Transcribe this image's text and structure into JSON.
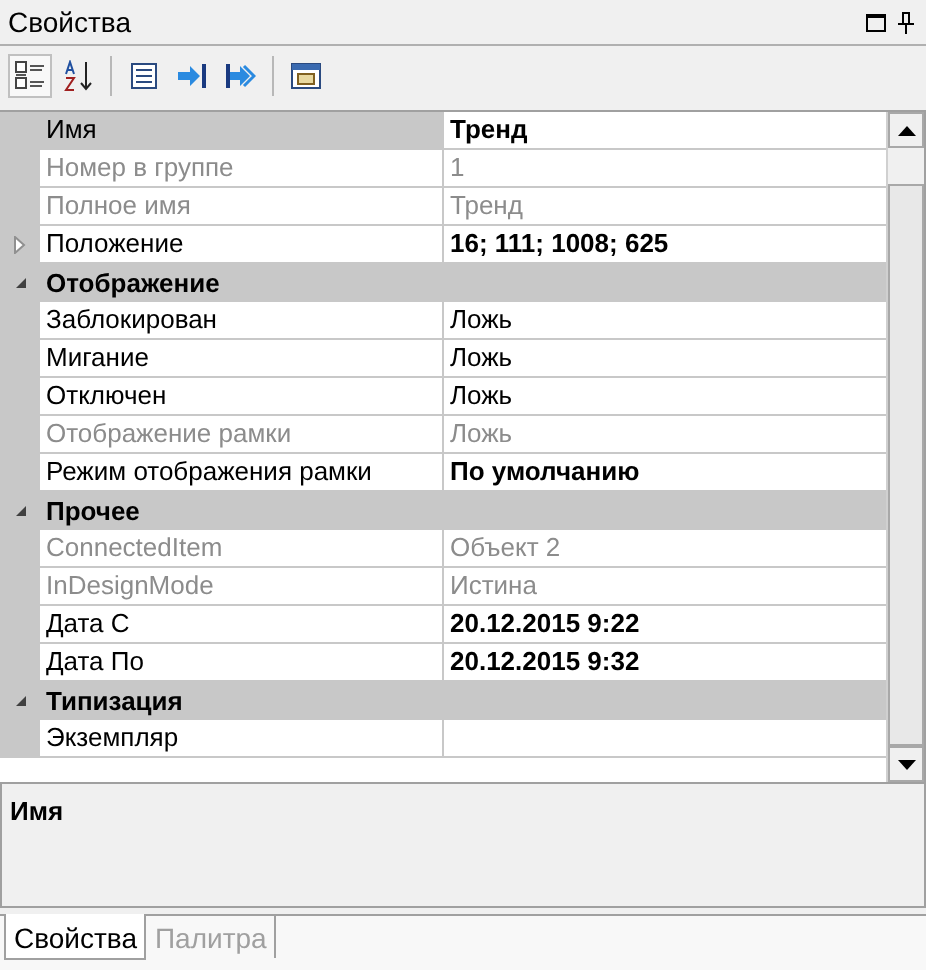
{
  "panel": {
    "title": "Свойства"
  },
  "toolbar": [
    {
      "kind": "categorized",
      "pressed": true
    },
    {
      "kind": "alphabetical",
      "pressed": false
    },
    {
      "kind": "separator"
    },
    {
      "kind": "properties",
      "pressed": false
    },
    {
      "kind": "arrow-bar",
      "pressed": false
    },
    {
      "kind": "double-arrow",
      "pressed": false
    },
    {
      "kind": "separator"
    },
    {
      "kind": "window",
      "pressed": false
    }
  ],
  "grid": {
    "groups": [
      {
        "rows": [
          {
            "name": "Имя",
            "value": "Тренд",
            "readonly": false,
            "modified": true,
            "selected": true,
            "expandable": false
          },
          {
            "name": "Номер в группе",
            "value": "1",
            "readonly": true,
            "modified": false,
            "selected": false,
            "expandable": false
          },
          {
            "name": "Полное имя",
            "value": "Тренд",
            "readonly": true,
            "modified": false,
            "selected": false,
            "expandable": false
          },
          {
            "name": "Положение",
            "value": "16; 111; 1008; 625",
            "readonly": false,
            "modified": true,
            "selected": false,
            "expandable": true
          }
        ]
      },
      {
        "title": "Отображение",
        "expanded": true,
        "rows": [
          {
            "name": "Заблокирован",
            "value": "Ложь",
            "readonly": false,
            "modified": false,
            "selected": false,
            "expandable": false
          },
          {
            "name": "Мигание",
            "value": "Ложь",
            "readonly": false,
            "modified": false,
            "selected": false,
            "expandable": false
          },
          {
            "name": "Отключен",
            "value": "Ложь",
            "readonly": false,
            "modified": false,
            "selected": false,
            "expandable": false
          },
          {
            "name": "Отображение рамки",
            "value": "Ложь",
            "readonly": true,
            "modified": false,
            "selected": false,
            "expandable": false
          },
          {
            "name": "Режим отображения рамки",
            "value": "По умолчанию",
            "readonly": false,
            "modified": true,
            "selected": false,
            "expandable": false
          }
        ]
      },
      {
        "title": "Прочее",
        "expanded": true,
        "rows": [
          {
            "name": "ConnectedItem",
            "value": "Объект 2",
            "readonly": true,
            "modified": false,
            "selected": false,
            "expandable": false
          },
          {
            "name": "InDesignMode",
            "value": "Истина",
            "readonly": true,
            "modified": false,
            "selected": false,
            "expandable": false
          },
          {
            "name": "Дата С",
            "value": "20.12.2015 9:22",
            "readonly": false,
            "modified": true,
            "selected": false,
            "expandable": false
          },
          {
            "name": "Дата По",
            "value": "20.12.2015 9:32",
            "readonly": false,
            "modified": true,
            "selected": false,
            "expandable": false
          }
        ]
      },
      {
        "title": "Типизация",
        "expanded": true,
        "rows": [
          {
            "name": "Экземпляр",
            "readonly": false,
            "selected": false,
            "expandable": false
          }
        ]
      }
    ]
  },
  "description": {
    "title": "Имя"
  },
  "tabs": [
    {
      "label": "Свойства",
      "selected": true
    },
    {
      "label": "Палитра",
      "selected": false
    }
  ]
}
